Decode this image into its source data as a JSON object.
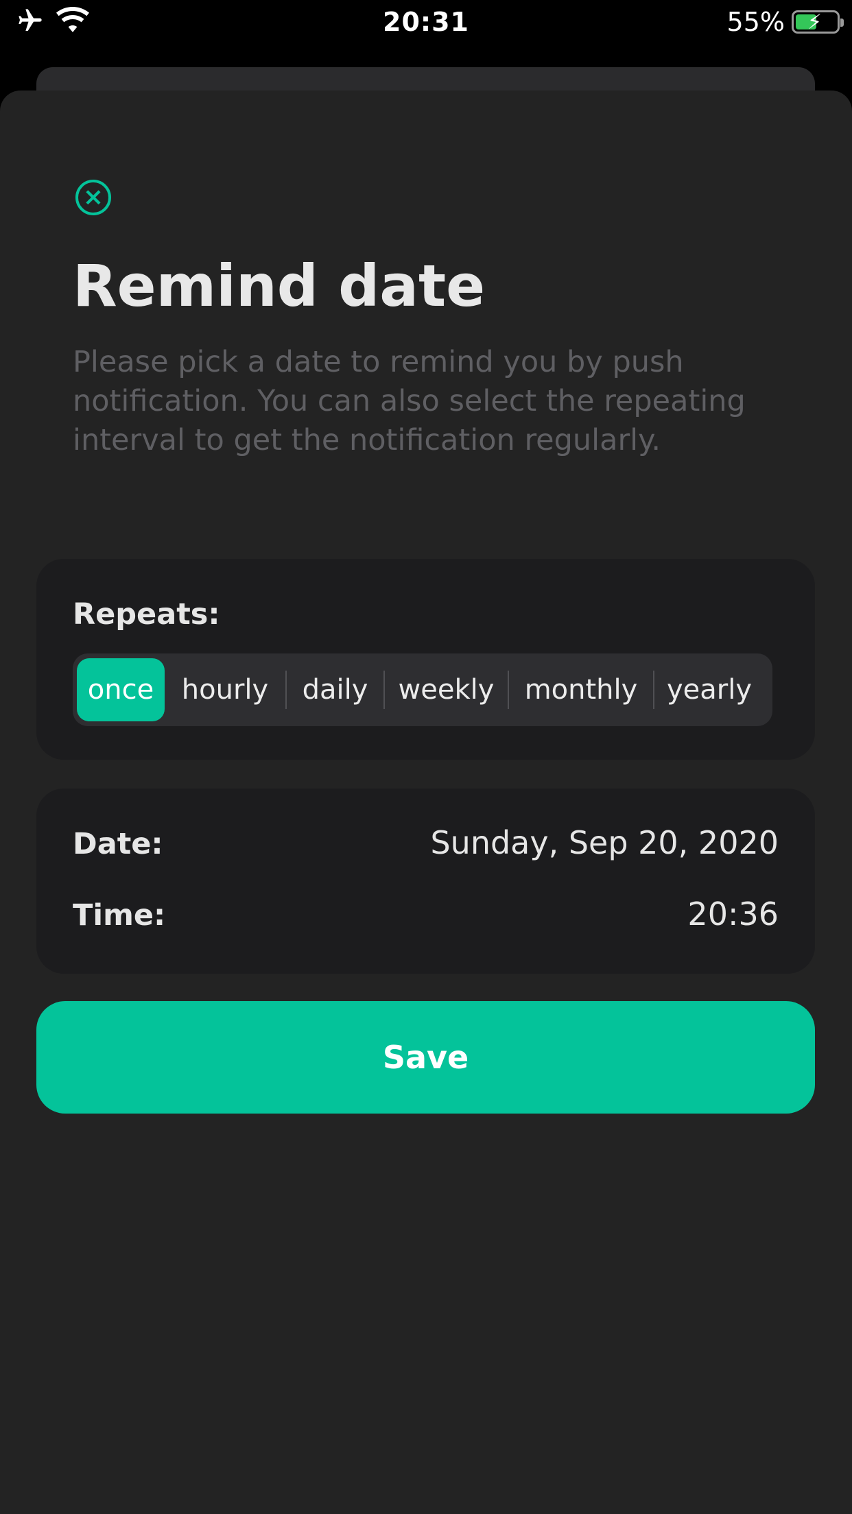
{
  "status_bar": {
    "time": "20:31",
    "battery_percent": "55%",
    "icons": [
      "airplane-icon",
      "wifi-icon",
      "battery-charging-icon"
    ]
  },
  "sheet": {
    "close_icon": "close-circle-icon",
    "title": "Remind date",
    "description": "Please pick a date to remind you by push notification. You can also select the repeating interval to get the notification regularly."
  },
  "repeats": {
    "label": "Repeats:",
    "options": [
      "once",
      "hourly",
      "daily",
      "weekly",
      "monthly",
      "yearly"
    ],
    "selected": "once"
  },
  "schedule": {
    "date_label": "Date:",
    "date_value": "Sunday, Sep 20, 2020",
    "time_label": "Time:",
    "time_value": "20:36"
  },
  "actions": {
    "save_label": "Save"
  },
  "colors": {
    "accent": "#04c39a",
    "background": "#232323",
    "card": "#1c1c1e",
    "muted_text": "#5f5f63"
  }
}
